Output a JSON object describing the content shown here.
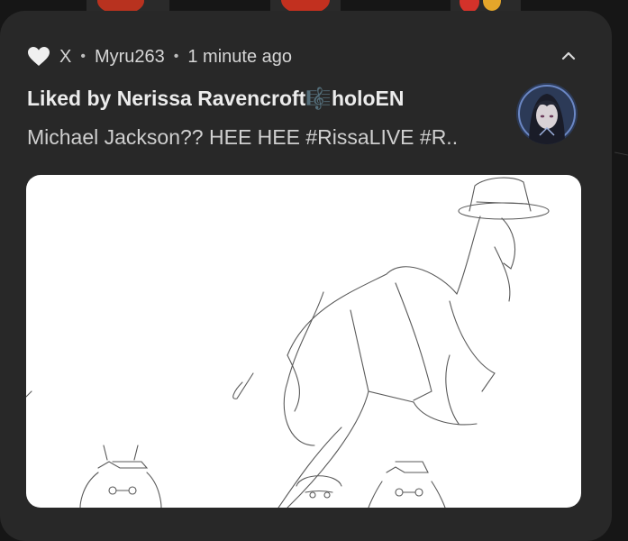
{
  "notification": {
    "app_icon": "heart-icon",
    "app_name": "X",
    "separator": "•",
    "account": "Myru263",
    "time": "1 minute ago",
    "collapse_icon": "chevron-up-icon",
    "title": "Liked by Nerissa Ravencroft🎼holoEN",
    "body": "Michael Jackson?? HEE HEE #RissaLIVE #R..",
    "avatar_icon": "avatar",
    "media_image": "sketch-image"
  },
  "colors": {
    "card_bg": "#282828",
    "title_text": "#ececec",
    "body_text": "#cfcfcf",
    "meta_text": "#d6d6d6"
  }
}
